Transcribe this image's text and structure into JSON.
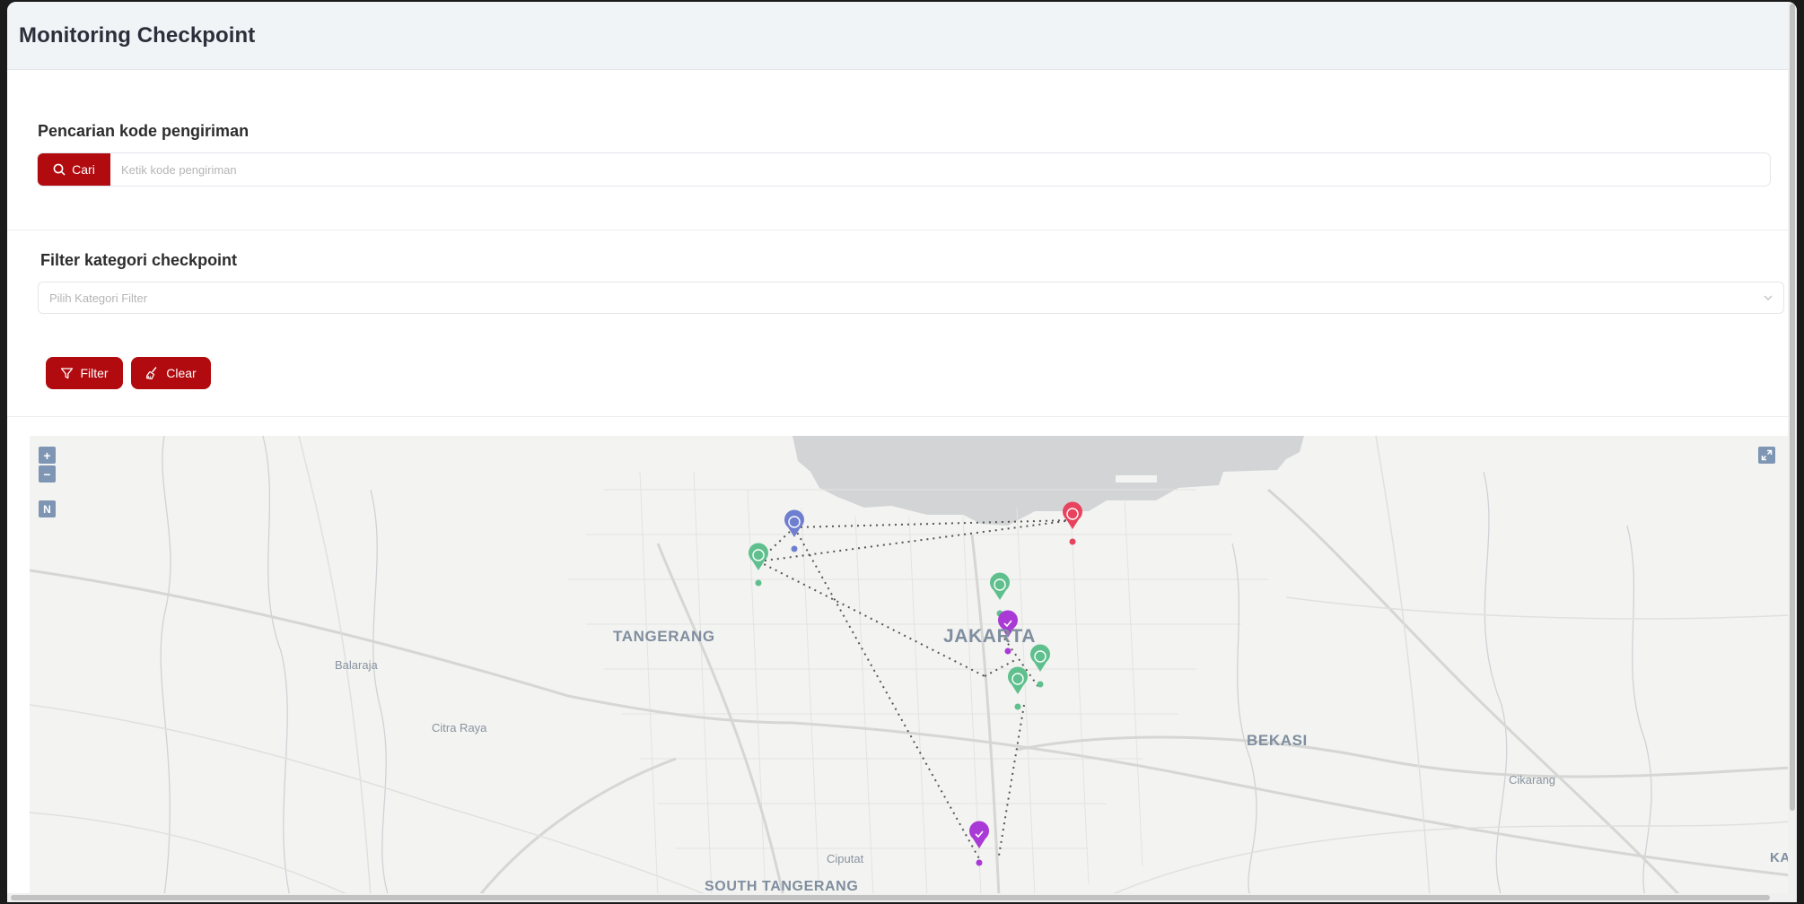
{
  "header": {
    "title": "Monitoring Checkpoint"
  },
  "search": {
    "label": "Pencarian kode pengiriman",
    "button_label": "Cari",
    "placeholder": "Ketik kode pengiriman"
  },
  "filter": {
    "label": "Filter kategori checkpoint",
    "select_placeholder": "Pilih Kategori Filter",
    "filter_button": "Filter",
    "clear_button": "Clear"
  },
  "map": {
    "controls": {
      "zoom_in": "+",
      "zoom_out": "−",
      "north": "N"
    },
    "places": {
      "tangerang": "TANGERANG",
      "jakarta": "JAKARTA",
      "balaraja": "Balaraja",
      "citra_raya": "Citra Raya",
      "bekasi": "BEKASI",
      "cikarang": "Cikarang",
      "ciputat": "Ciputat",
      "south_tangerang": "SOUTH TANGERANG",
      "ka": "KA"
    },
    "marker_colors": {
      "blue": "#6f7fd0",
      "green": "#5fc08e",
      "red": "#e8435e",
      "purple": "#a93ad6"
    },
    "route_color": "#555555"
  },
  "icons": {
    "search": "search-icon",
    "filter": "funnel-icon",
    "clear": "broom-icon",
    "chevron": "chevron-down-icon",
    "fullscreen": "expand-icon"
  }
}
